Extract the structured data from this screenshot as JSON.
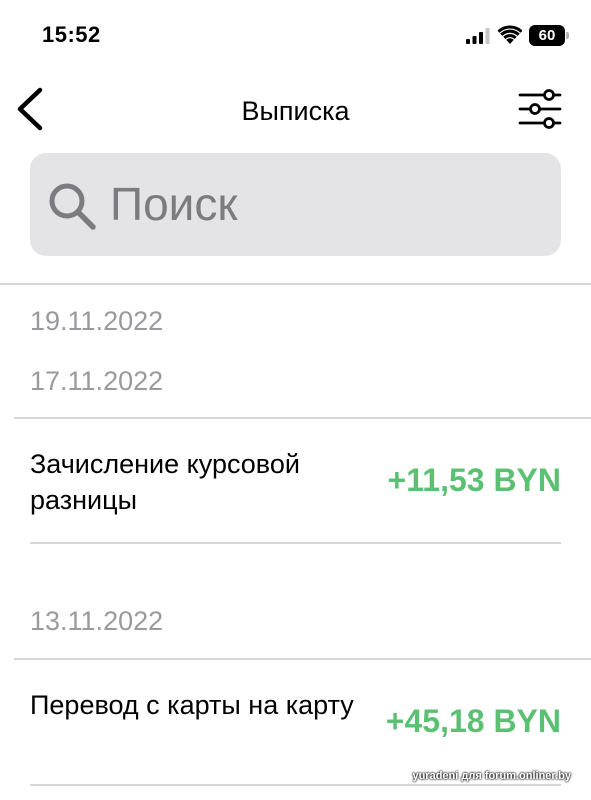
{
  "status_bar": {
    "time": "15:52",
    "battery_level": "60",
    "icons": [
      "signal-icon",
      "wifi-icon",
      "battery-icon"
    ]
  },
  "nav": {
    "title": "Выписка",
    "back_icon": "chevron-left-icon",
    "filter_icon": "sliders-icon"
  },
  "search": {
    "placeholder": "Поиск",
    "icon": "search-icon"
  },
  "dates": [
    "19.11.2022",
    "17.11.2022",
    "13.11.2022"
  ],
  "transactions": [
    {
      "title": "Зачисление курсовой разницы",
      "amount": "+11,53 BYN"
    },
    {
      "title": "Перевод с карты на карту",
      "amount": "+45,18 BYN"
    }
  ],
  "colors": {
    "amount_positive": "#5cc073",
    "search_bg": "#e4e4e6",
    "date_text": "#9a9a9e",
    "divider": "#d6d6d8"
  },
  "watermark": "yuradeni для forum.onliner.by"
}
